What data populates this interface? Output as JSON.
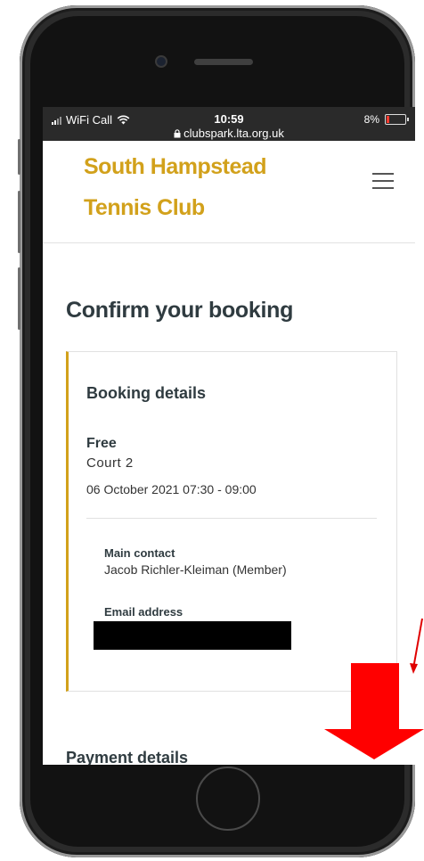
{
  "status_bar": {
    "carrier": "WiFi Call",
    "time": "10:59",
    "url": "clubspark.lta.org.uk",
    "battery": "8%",
    "icons": [
      "signal-icon",
      "wifi-icon",
      "lock-icon",
      "battery-icon"
    ]
  },
  "header": {
    "club_line1": "South Hampstead",
    "club_line2": "Tennis Club",
    "menu_icon": "hamburger-menu-icon",
    "brand_color": "#d2a11b"
  },
  "page": {
    "title": "Confirm your booking"
  },
  "booking": {
    "section_title": "Booking details",
    "price": "Free",
    "court": "Court 2",
    "datetime": "06 October 2021 07:30 - 09:00",
    "main_contact_label": "Main contact",
    "main_contact_value": "Jacob Richler-Kleiman (Member)",
    "email_label": "Email address"
  },
  "payment": {
    "section_title": "Payment details"
  },
  "annotation": {
    "arrow_color": "#ff0000",
    "icons": [
      "down-arrow-icon"
    ]
  }
}
